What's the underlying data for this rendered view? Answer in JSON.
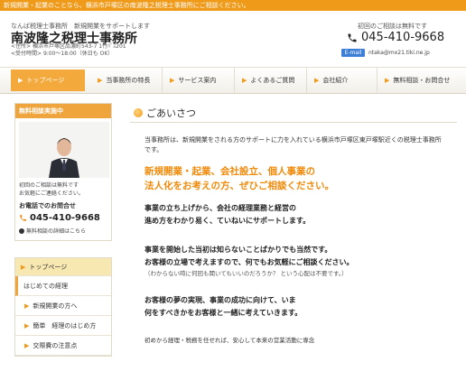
{
  "topbar": {
    "text": "新規開業・起業のことなら、横浜市戸塚区の南波隆之税理士事務所にご相談ください。"
  },
  "header": {
    "tagline": "なんば税理士事務所　新規開業をサポートします",
    "title": "南波隆之税理士事務所",
    "address": "<住所> 横浜市戸塚区品濃町543-7 1竹ﾊﾞｽ201",
    "hours": "<受付時間> 9:00～18:00（休日も OK）",
    "free_consult": "初回のご相談は無料です",
    "tel": "045-410-9668",
    "mail_badge": "E-mail",
    "mail": "ntaka@mx21.tiki.ne.jp"
  },
  "nav": {
    "items": [
      {
        "label": "トップページ",
        "active": true
      },
      {
        "label": "当事務所の特長"
      },
      {
        "label": "サービス案内"
      },
      {
        "label": "よくあるご質問"
      },
      {
        "label": "会社紹介"
      },
      {
        "label": "無料相談・お問合せ"
      }
    ]
  },
  "consult": {
    "heading": "無料相談実施中",
    "text1": "初回のご相談は無料です",
    "text2": "お気軽にご連絡ください。",
    "label": "お電話でのお問合せ",
    "tel": "045-410-9668",
    "free_link": "無料相談の詳細はこちら"
  },
  "side_nav": {
    "top": "トップページ",
    "items": [
      {
        "label": "はじめての経理",
        "current": true
      },
      {
        "label": "新規開業の方へ"
      },
      {
        "label": "簡単　経理のはじめ方"
      },
      {
        "label": "交際費の注意点"
      }
    ]
  },
  "main": {
    "heading": "ごあいさつ",
    "intro": "当事務所は、新規開業をされる方のサポートに力を入れている横浜市戸塚区東戸塚駅近くの税理士事務所です。",
    "catch1": "新規開業・起業、会社設立、個人事業の",
    "catch2": "法人化をお考えの方、ぜひご相談ください。",
    "p1a": "事業の立ち上げから、会社の経理業務と経営の",
    "p1b": "進め方をわかり易く、ていねいにサポートします。",
    "p2a": "事業を開始した当初は知らないことばかりでも当然です。",
    "p2b": "お客様の立場で考えますので、何でもお気軽にご相談ください。",
    "p2c": "（わからない時に何回も聞いてもいいのだろうか？ という心配は不要です。）",
    "p3a": "お客様の夢の実現、事業の成功に向けて、いま",
    "p3b": "何をすべきかをお客様と一緒に考えていきます。",
    "p4": "初めから経理・税務を任せれば、安心して本来の営業活動に専念"
  }
}
